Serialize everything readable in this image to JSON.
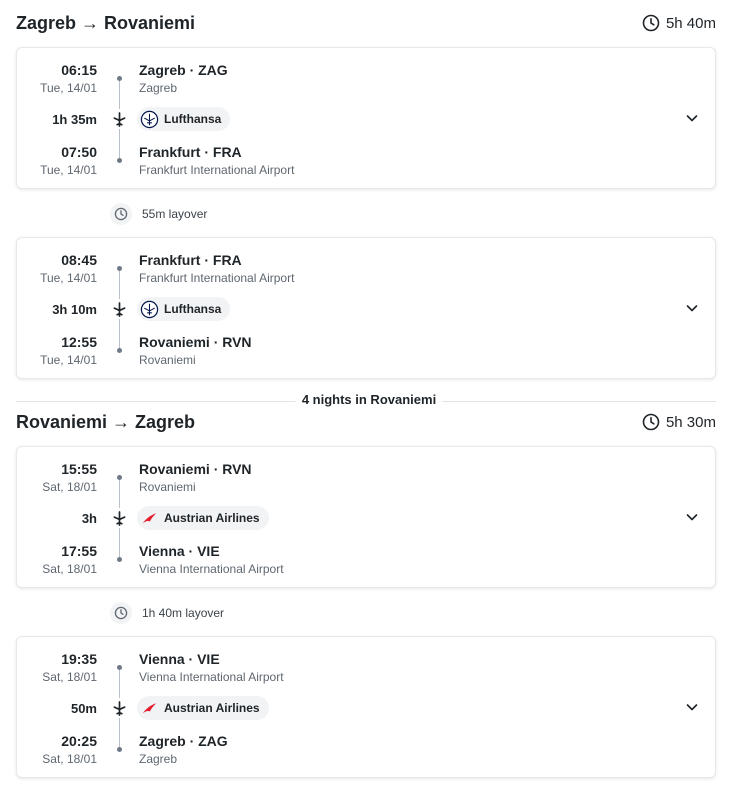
{
  "outbound": {
    "route": "Zagreb → Rovaniemi",
    "total_duration": "5h 40m",
    "segments": [
      {
        "dep_time": "06:15",
        "dep_date": "Tue, 14/01",
        "dep_place": "Zagreb · ZAG",
        "dep_airport": "Zagreb",
        "duration": "1h 35m",
        "airline": "Lufthansa",
        "arr_time": "07:50",
        "arr_date": "Tue, 14/01",
        "arr_place": "Frankfurt · FRA",
        "arr_airport": "Frankfurt International Airport"
      },
      {
        "dep_time": "08:45",
        "dep_date": "Tue, 14/01",
        "dep_place": "Frankfurt · FRA",
        "dep_airport": "Frankfurt International Airport",
        "duration": "3h 10m",
        "airline": "Lufthansa",
        "arr_time": "12:55",
        "arr_date": "Tue, 14/01",
        "arr_place": "Rovaniemi · RVN",
        "arr_airport": "Rovaniemi"
      }
    ],
    "layover": "55m layover"
  },
  "stay": "4 nights in Rovaniemi",
  "return": {
    "route": "Rovaniemi → Zagreb",
    "total_duration": "5h 30m",
    "segments": [
      {
        "dep_time": "15:55",
        "dep_date": "Sat, 18/01",
        "dep_place": "Rovaniemi · RVN",
        "dep_airport": "Rovaniemi",
        "duration": "3h",
        "airline": "Austrian Airlines",
        "arr_time": "17:55",
        "arr_date": "Sat, 18/01",
        "arr_place": "Vienna · VIE",
        "arr_airport": "Vienna International Airport"
      },
      {
        "dep_time": "19:35",
        "dep_date": "Sat, 18/01",
        "dep_place": "Vienna · VIE",
        "dep_airport": "Vienna International Airport",
        "duration": "50m",
        "airline": "Austrian Airlines",
        "arr_time": "20:25",
        "arr_date": "Sat, 18/01",
        "arr_place": "Zagreb · ZAG",
        "arr_airport": "Zagreb"
      }
    ],
    "layover": "1h 40m layover"
  },
  "icons": {
    "clock": "clock-icon",
    "plane": "plane-icon",
    "expand": "chevron-down-icon",
    "lufthansa_logo": "lufthansa-logo-icon",
    "austrian_logo": "austrian-logo-icon"
  },
  "colors": {
    "text": "#1f2428",
    "muted": "#5f6770",
    "austrian_red": "#e4202f",
    "border": "#e6e8eb"
  }
}
